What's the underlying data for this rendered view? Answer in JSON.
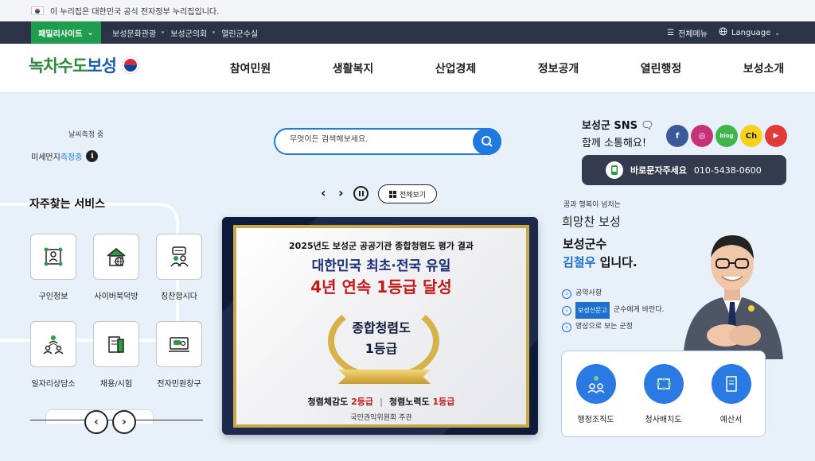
{
  "gov_banner": {
    "text": "이 누리집은 대한민국 공식 전자정부 누리집입니다."
  },
  "topnav": {
    "family_site": "패밀리사이트",
    "links": [
      "보성문화관광",
      "보성군의회",
      "열린군수실"
    ],
    "all_menu": "전체메뉴",
    "language": "Language"
  },
  "header": {
    "logo_green": "녹차수도",
    "logo_blue": "보성",
    "gnb": [
      "참여민원",
      "생활복지",
      "산업경제",
      "정보공개",
      "열린행정",
      "보성소개"
    ]
  },
  "weather": {
    "status": "날씨측정 중",
    "dust_label": "미세먼지",
    "dust_value": "측정중"
  },
  "services": {
    "title": "자주찾는 서비스",
    "items": [
      {
        "label": "구인정보",
        "icon": "job-search-icon"
      },
      {
        "label": "사이버북덕방",
        "icon": "house-globe-icon"
      },
      {
        "label": "칭찬합시다",
        "icon": "praise-person-icon"
      },
      {
        "label": "일자리상담소",
        "icon": "people-network-icon"
      },
      {
        "label": "채용/시험",
        "icon": "document-exam-icon"
      },
      {
        "label": "전자민원창구",
        "icon": "computer-chat-icon"
      }
    ]
  },
  "search": {
    "placeholder": "무엇이든 검색해보세요."
  },
  "slider": {
    "view_all": "전체보기"
  },
  "banner": {
    "line1": "2025년도 보성군 공공기관 종합청렴도 평가 결과",
    "line2": "대한민국 최초·전국 유일",
    "line3": "4년 연속 1등급 달성",
    "award1": "종합청렴도",
    "award2": "1등급",
    "line4a_label": "청렴체감도",
    "line4a_value": "2등급",
    "line4b_label": "청렴노력도",
    "line4b_value": "1등급",
    "line5": "국민권익위원회 주관"
  },
  "sns": {
    "title1": "보성군 SNS",
    "title2": "함께 소통해요!",
    "icons": [
      {
        "name": "facebook",
        "glyph": "f",
        "color": "#3b5a9a"
      },
      {
        "name": "instagram",
        "glyph": "◎",
        "color": "#c7337b"
      },
      {
        "name": "blog",
        "glyph": "blog",
        "color": "#3db54a"
      },
      {
        "name": "kakao-channel",
        "glyph": "Ch",
        "color": "#f7d21c"
      },
      {
        "name": "youtube",
        "glyph": "▶",
        "color": "#e03a3a"
      }
    ]
  },
  "contact": {
    "label": "바로문자주세요",
    "number": "010-5438-0600"
  },
  "mayor": {
    "sub": "꿈과 행복이 넘치는",
    "slogan": "희망찬 보성",
    "line1": "보성군수",
    "name": "김철우",
    "line2_suffix": " 입니다.",
    "links": [
      {
        "text": "공약사항",
        "tag": ""
      },
      {
        "text": "군수에게 바란다.",
        "tag": "보성신문고"
      },
      {
        "text": "영상으로 보는 군정",
        "tag": ""
      }
    ]
  },
  "quick": [
    {
      "label": "행정조직도",
      "icon": "org-chart-icon"
    },
    {
      "label": "청사배치도",
      "icon": "building-layout-icon"
    },
    {
      "label": "예산서",
      "icon": "budget-book-icon"
    }
  ]
}
